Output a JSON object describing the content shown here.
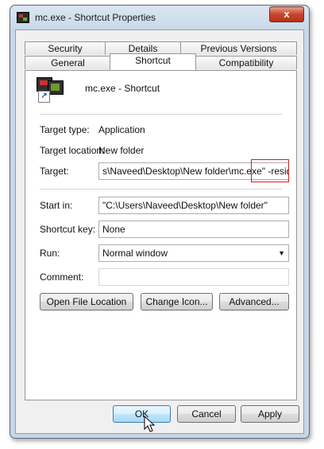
{
  "window": {
    "title": "mc.exe - Shortcut Properties",
    "close_label": "x"
  },
  "tabs_row1": [
    "Security",
    "Details",
    "Previous Versions"
  ],
  "tabs_row2": [
    "General",
    "Shortcut",
    "Compatibility"
  ],
  "active_tab": "Shortcut",
  "shortcut": {
    "name": "mc.exe - Shortcut",
    "target_type_label": "Target type:",
    "target_type_value": "Application",
    "target_location_label": "Target location:",
    "target_location_value": "New folder",
    "target_label": "Target:",
    "target_value": "s\\Naveed\\Desktop\\New folder\\mc.exe\" -resident",
    "start_in_label": "Start in:",
    "start_in_value": "\"C:\\Users\\Naveed\\Desktop\\New folder\"",
    "shortcut_key_label": "Shortcut key:",
    "shortcut_key_value": "None",
    "run_label": "Run:",
    "run_value": "Normal window",
    "comment_label": "Comment:",
    "comment_value": ""
  },
  "buttons": {
    "open_file_location": "Open File Location",
    "change_icon": "Change Icon...",
    "advanced": "Advanced...",
    "ok": "OK",
    "cancel": "Cancel",
    "apply": "Apply"
  },
  "colors": {
    "highlight": "#d21e1e",
    "default_button": "#3c7fb1"
  }
}
